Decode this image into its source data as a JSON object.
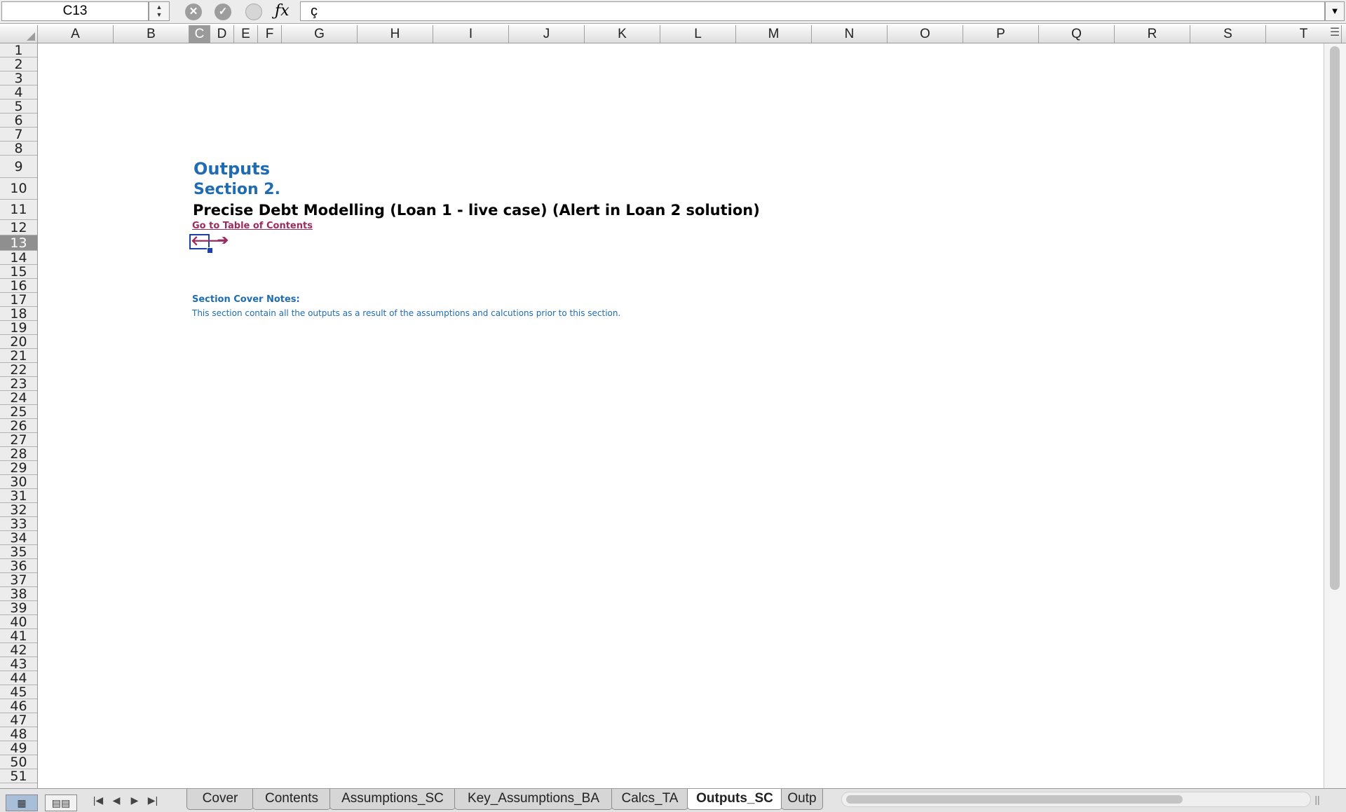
{
  "formula_bar": {
    "name_box": "C13",
    "stepper": "▲▼",
    "cancel_glyph": "✕",
    "confirm_glyph": "✓",
    "function_glyph": "ƒx",
    "formula_value": "ç",
    "dropdown_glyph": "▼"
  },
  "columns": [
    "A",
    "B",
    "C",
    "D",
    "E",
    "F",
    "G",
    "H",
    "I",
    "J",
    "K",
    "L",
    "M",
    "N",
    "O",
    "P",
    "Q",
    "R",
    "S",
    "T"
  ],
  "selected_column": "C",
  "rows": [
    "1",
    "2",
    "3",
    "4",
    "5",
    "6",
    "7",
    "8",
    "9",
    "10",
    "11",
    "12",
    "13",
    "14",
    "15",
    "16",
    "17",
    "18",
    "19",
    "20",
    "21",
    "22",
    "23",
    "24",
    "25",
    "26",
    "27",
    "28",
    "29",
    "30",
    "31",
    "32",
    "33",
    "34",
    "35",
    "36",
    "37",
    "38",
    "39",
    "40",
    "41",
    "42",
    "43",
    "44",
    "45",
    "46",
    "47",
    "48",
    "49",
    "50",
    "51"
  ],
  "selected_row": "13",
  "cells": {
    "outputs_heading": "Outputs",
    "section_heading": "Section 2.",
    "model_title": "Precise Debt Modelling (Loan 1 - live case) (Alert in Loan 2 solution)",
    "toc_link": "Go to Table of Contents",
    "prev_arrow": "🡐",
    "next_arrow": "➔",
    "cover_notes_title": "Section Cover Notes:",
    "cover_notes_body": "This section contain all the outputs as a result of the assumptions and calcutions prior to this section."
  },
  "bottom_bar": {
    "normal_view": "▦",
    "page_layout_view": "▤▤",
    "nav": [
      "|◀",
      "◀",
      "▶",
      "▶|"
    ],
    "sheet_tabs": [
      "Cover",
      "Contents",
      "Assumptions_SC",
      "Key_Assumptions_BA",
      "Calcs_TA",
      "Outputs_SC",
      "Outp"
    ],
    "active_tab": "Outputs_SC",
    "split_handle": "||"
  },
  "colors": {
    "heading_blue": "#1f6cb3",
    "link_maroon": "#9b2b5f",
    "selection_border": "#1d3fa8"
  }
}
